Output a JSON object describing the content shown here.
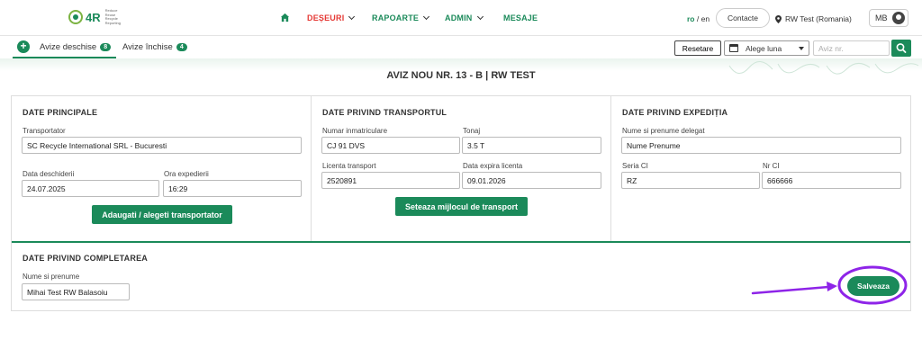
{
  "header": {
    "logo_text": "4R",
    "logo_sub": [
      "Reduce",
      "Reuse",
      "Recycle",
      "Reporting"
    ],
    "nav": [
      {
        "label": "DEȘEURI",
        "color": "#e53935"
      },
      {
        "label": "RAPOARTE",
        "color": "#1b8a5a"
      },
      {
        "label": "ADMIN",
        "color": "#1b8a5a"
      },
      {
        "label": "MESAJE",
        "color": "#1b8a5a"
      }
    ],
    "lang_active": "ro",
    "lang_sep": " / ",
    "lang_other": "en",
    "contact_label": "Contacte",
    "company": "RW Test (Romania)",
    "user_initials": "MB"
  },
  "subbar": {
    "add_label": "+",
    "tabs": [
      {
        "label": "Avize deschise",
        "count": "8"
      },
      {
        "label": "Avize închise",
        "count": "4"
      }
    ],
    "reset_label": "Resetare",
    "month_label": "Alege luna",
    "search_placeholder": "Aviz nr."
  },
  "page_title": "AVIZ NOU NR. 13 - B | RW TEST",
  "sections": {
    "principale": {
      "title": "DATE PRINCIPALE",
      "transportator_label": "Transportator",
      "transportator_value": "SC Recycle International SRL - Bucuresti",
      "data_label": "Data deschiderii",
      "data_value": "24.07.2025",
      "ora_label": "Ora expedierii",
      "ora_value": "16:29",
      "button": "Adaugati / alegeti transportator"
    },
    "transport": {
      "title": "DATE PRIVIND TRANSPORTUL",
      "nr_label": "Numar inmatriculare",
      "nr_value": "CJ 91 DVS",
      "tonaj_label": "Tonaj",
      "tonaj_value": "3.5 T",
      "licenta_label": "Licenta transport",
      "licenta_value": "2520891",
      "expira_label": "Data expira licenta",
      "expira_value": "09.01.2026",
      "button": "Seteaza mijlocul de transport"
    },
    "expeditia": {
      "title": "DATE PRIVIND EXPEDIȚIA",
      "delegat_label": "Nume si prenume delegat",
      "delegat_value": "Nume Prenume",
      "seria_label": "Seria CI",
      "seria_value": "RZ",
      "nr_label": "Nr CI",
      "nr_value": "666666"
    },
    "completarea": {
      "title": "DATE PRIVIND COMPLETAREA",
      "nume_label": "Nume si prenume",
      "nume_value": "Mihai Test RW Balasoiu"
    }
  },
  "save_label": "Salveaza",
  "colors": {
    "primary": "#1b8a5a",
    "nav_active": "#e53935",
    "annotation": "#8e24e8"
  }
}
